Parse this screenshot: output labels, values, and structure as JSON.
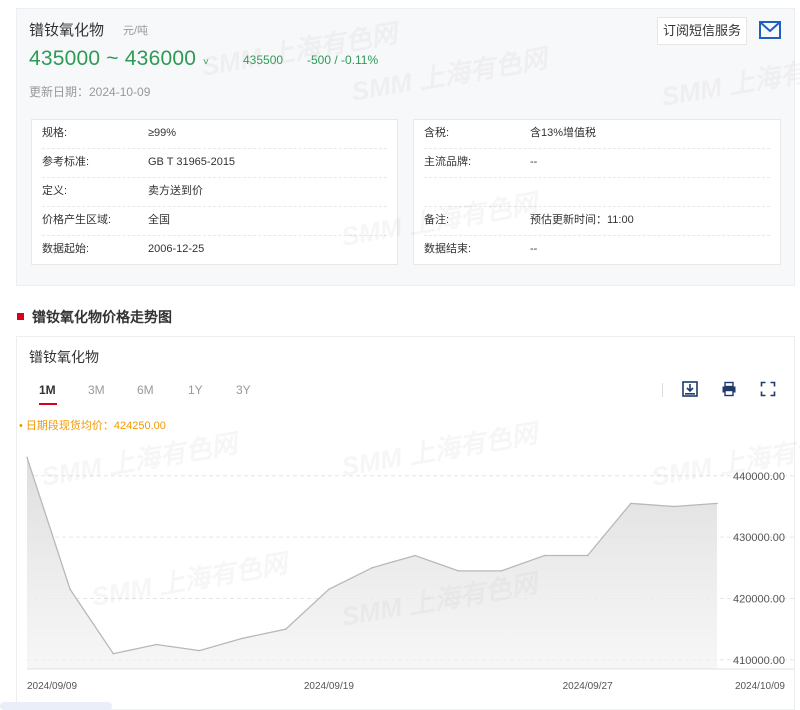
{
  "product": {
    "name": "镨钕氧化物",
    "unit": "元/吨",
    "price_range": "435000 ~ 436000",
    "avg_price": "435500",
    "change": "-500 / -0.11%",
    "update_date": "更新日期：2024-10-09",
    "trend_color": "#2e9a55"
  },
  "subscribe": {
    "label": "订阅短信服务"
  },
  "info_left": [
    {
      "key": "规格:",
      "value": "≥99%"
    },
    {
      "key": "参考标准:",
      "value": "GB T 31965-2015"
    },
    {
      "key": "定义:",
      "value": "卖方送到价"
    },
    {
      "key": "价格产生区域:",
      "value": "全国"
    },
    {
      "key": "数据起始:",
      "value": "2006-12-25"
    }
  ],
  "info_right": [
    {
      "key": "含税:",
      "value": "含13%增值税"
    },
    {
      "key": "主流品牌:",
      "value": "--"
    },
    {
      "key": "",
      "value": ""
    },
    {
      "key": "备注:",
      "value": "预估更新时间：11:00"
    },
    {
      "key": "数据结束:",
      "value": "--"
    }
  ],
  "section": {
    "title": "镨钕氧化物价格走势图"
  },
  "chart_card": {
    "name": "镨钕氧化物",
    "tabs": [
      "1M",
      "3M",
      "6M",
      "1Y",
      "3Y"
    ],
    "active_tab": "1M",
    "avg_label": "• 日期段现货均价：424250.00",
    "watermark": "SMM 上海有色网"
  },
  "chart_data": {
    "type": "area",
    "x": [
      "2024/09/09",
      "2024/09/10",
      "2024/09/11",
      "2024/09/12",
      "2024/09/13",
      "2024/09/16",
      "2024/09/18",
      "2024/09/19",
      "2024/09/20",
      "2024/09/23",
      "2024/09/24",
      "2024/09/25",
      "2024/09/26",
      "2024/09/27",
      "2024/09/30",
      "2024/10/08",
      "2024/10/09"
    ],
    "values": [
      443000,
      421500,
      411000,
      412500,
      411500,
      413500,
      415000,
      421500,
      425000,
      427000,
      424500,
      424500,
      427000,
      427000,
      435500,
      435000,
      435500
    ],
    "x_tick_labels": [
      "2024/09/09",
      "2024/09/19",
      "2024/09/27",
      "2024/10/09"
    ],
    "y_ticks": [
      410000,
      420000,
      430000,
      440000
    ],
    "y_tick_labels": [
      "410000.00",
      "420000.00",
      "430000.00",
      "440000.00"
    ],
    "ylim": [
      408500,
      446000
    ],
    "line_color": "#b8b8b8",
    "grid": "dashed horizontal"
  }
}
